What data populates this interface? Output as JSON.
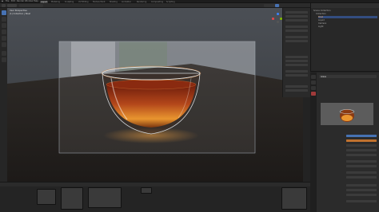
{
  "topbar": {
    "menus": [
      "File",
      "Edit",
      "Render",
      "Window",
      "Help"
    ],
    "tabs": [
      "Layout",
      "Modeling",
      "Sculpting",
      "UV Editing",
      "Texture Paint",
      "Shading",
      "Animation",
      "Rendering",
      "Compositing",
      "Scripting"
    ],
    "active_tab_index": 0
  },
  "viewport": {
    "view_label": "User Perspective",
    "collection_label": "(1) Collection | Bowl"
  },
  "outliner": {
    "items": [
      "Scene Collection",
      "Collection",
      "Bowl",
      "Liquid",
      "Camera",
      "Light"
    ]
  },
  "properties": {
    "material_name": "Glass"
  },
  "colors": {
    "accent": "#4772b3",
    "liquid": "#b3461a",
    "selection": "#e9852c"
  }
}
